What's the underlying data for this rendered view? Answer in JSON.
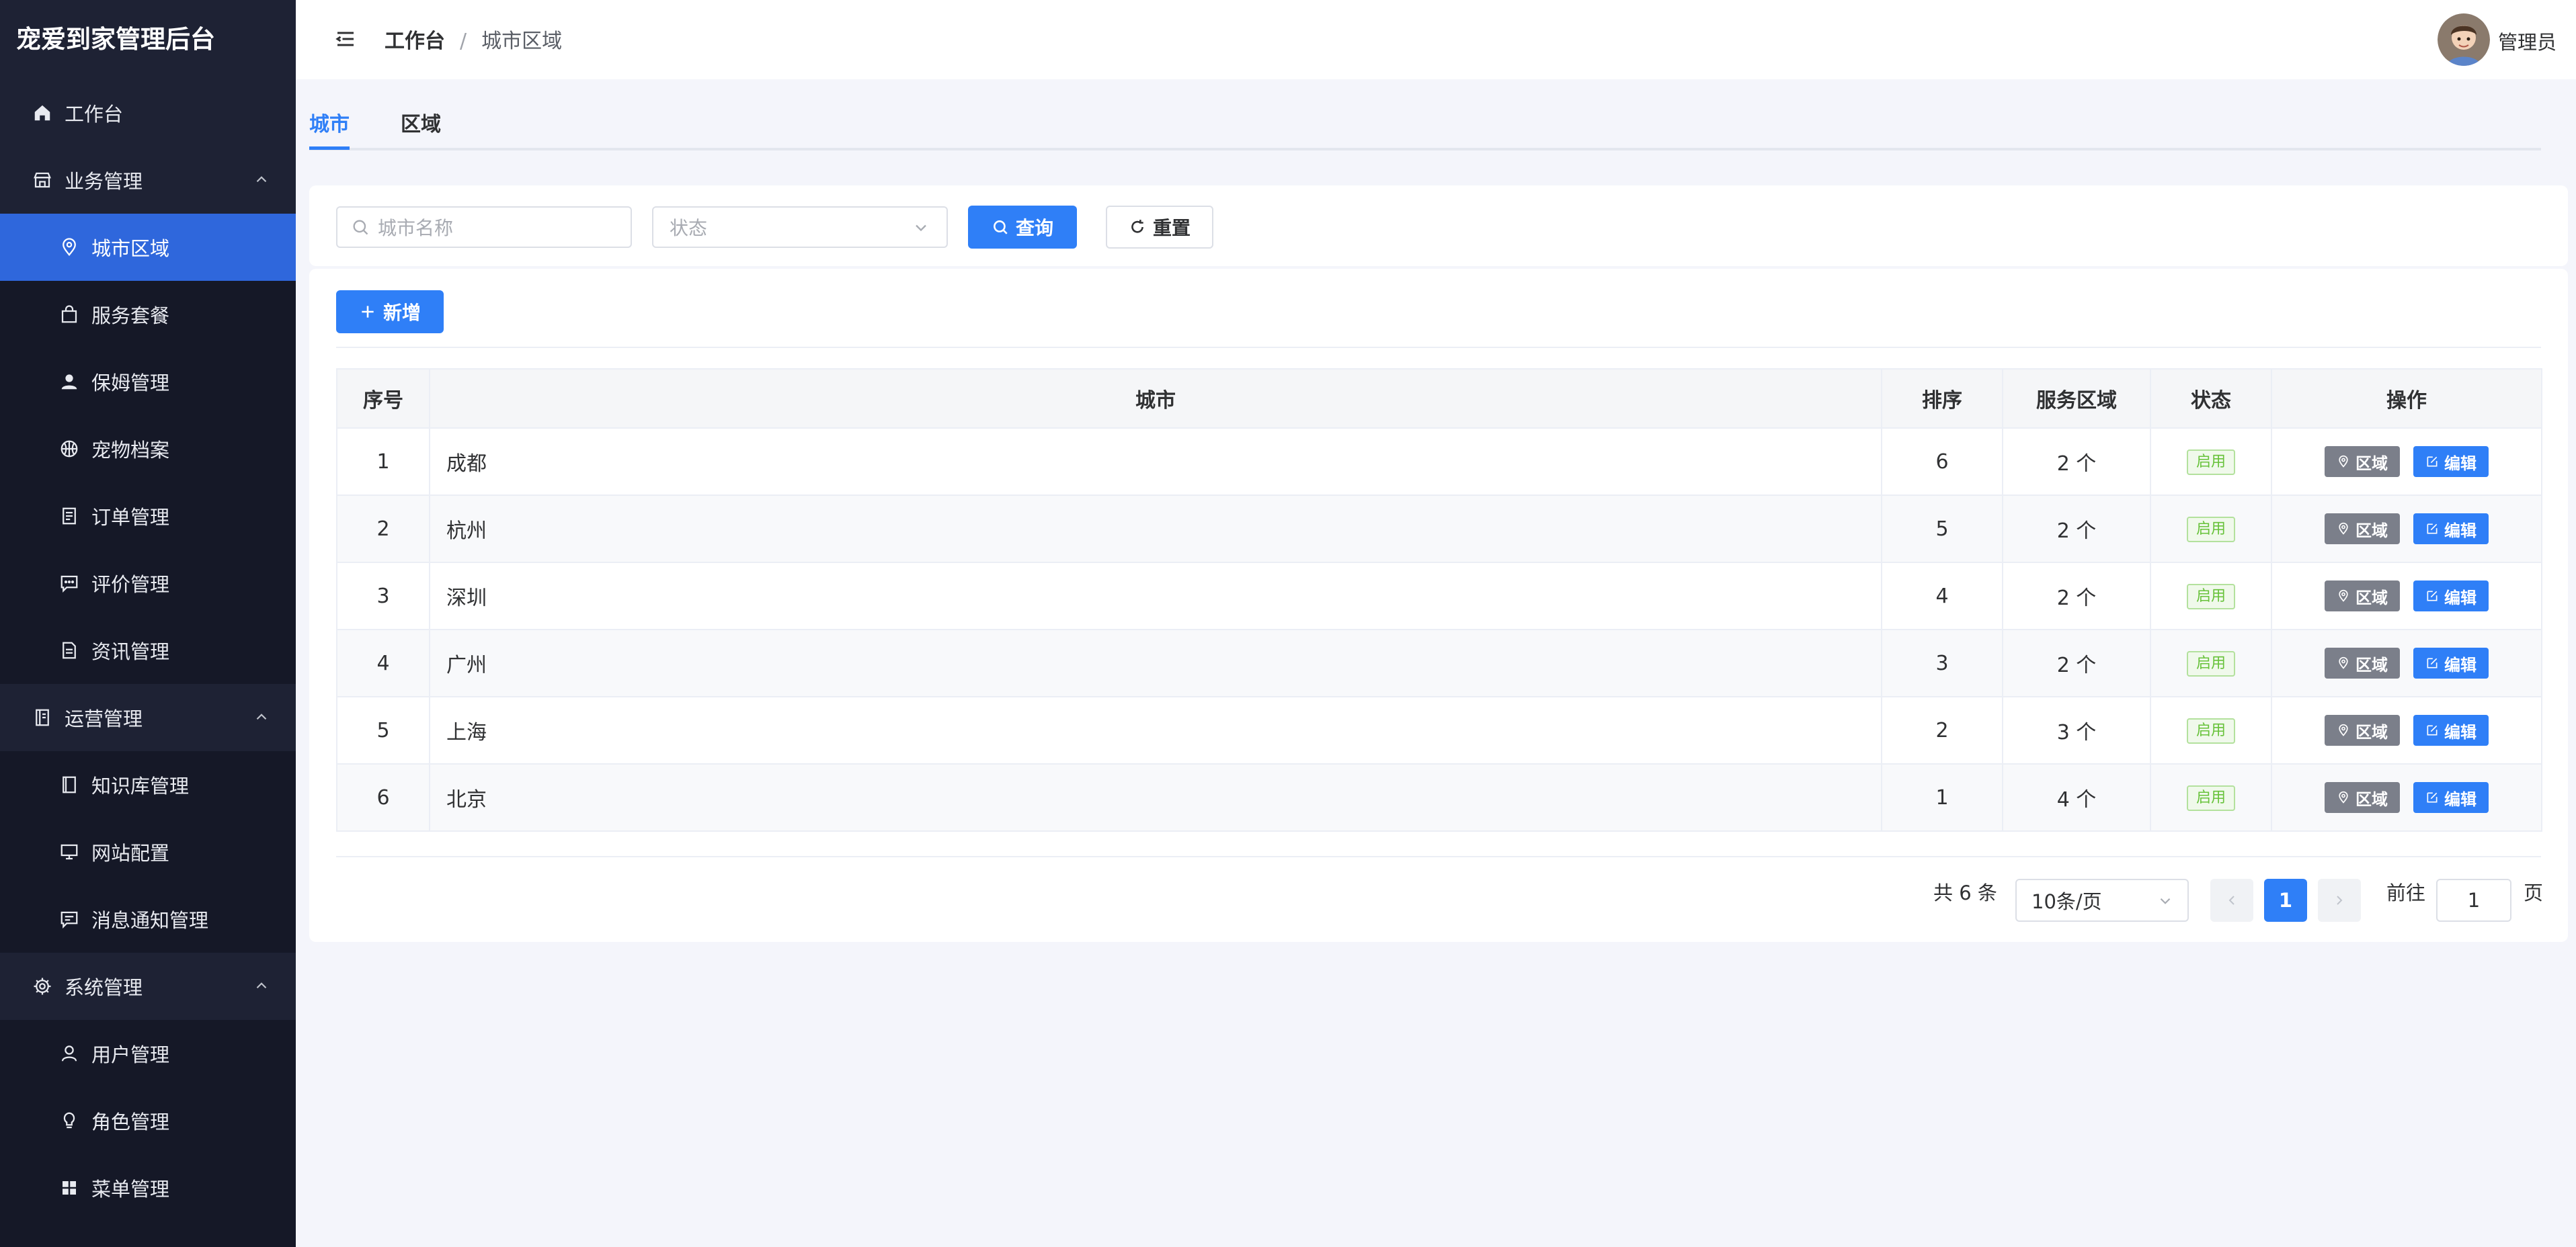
{
  "brand": "宠爱到家管理后台",
  "sidebar": {
    "items": [
      {
        "label": "工作台",
        "icon": "home-icon"
      },
      {
        "label": "业务管理",
        "icon": "store-icon"
      },
      {
        "label": "城市区域",
        "icon": "map-pin-icon"
      },
      {
        "label": "服务套餐",
        "icon": "bag-icon"
      },
      {
        "label": "保姆管理",
        "icon": "user-filled-icon"
      },
      {
        "label": "宠物档案",
        "icon": "basketball-icon"
      },
      {
        "label": "订单管理",
        "icon": "document-icon"
      },
      {
        "label": "评价管理",
        "icon": "chat-icon"
      },
      {
        "label": "资讯管理",
        "icon": "news-icon"
      },
      {
        "label": "运营管理",
        "icon": "notebook-icon"
      },
      {
        "label": "知识库管理",
        "icon": "book-icon"
      },
      {
        "label": "网站配置",
        "icon": "monitor-icon"
      },
      {
        "label": "消息通知管理",
        "icon": "message-icon"
      },
      {
        "label": "系统管理",
        "icon": "gear-icon"
      },
      {
        "label": "用户管理",
        "icon": "user-icon"
      },
      {
        "label": "角色管理",
        "icon": "bulb-icon"
      },
      {
        "label": "菜单管理",
        "icon": "grid-icon"
      }
    ]
  },
  "header": {
    "breadcrumb": [
      "工作台",
      "城市区域"
    ],
    "separator": "/",
    "username": "管理员"
  },
  "tabs": [
    "城市",
    "区域"
  ],
  "search": {
    "city_placeholder": "城市名称",
    "status_placeholder": "状态",
    "query_label": "查询",
    "reset_label": "重置"
  },
  "toolbar": {
    "add_label": "新增"
  },
  "table": {
    "headers": [
      "序号",
      "城市",
      "排序",
      "服务区域",
      "状态",
      "操作"
    ],
    "rows": [
      {
        "index": "1",
        "city": "成都",
        "sort": "6",
        "areas": "2 个",
        "status": "启用"
      },
      {
        "index": "2",
        "city": "杭州",
        "sort": "5",
        "areas": "2 个",
        "status": "启用"
      },
      {
        "index": "3",
        "city": "深圳",
        "sort": "4",
        "areas": "2 个",
        "status": "启用"
      },
      {
        "index": "4",
        "city": "广州",
        "sort": "3",
        "areas": "2 个",
        "status": "启用"
      },
      {
        "index": "5",
        "city": "上海",
        "sort": "2",
        "areas": "3 个",
        "status": "启用"
      },
      {
        "index": "6",
        "city": "北京",
        "sort": "1",
        "areas": "4 个",
        "status": "启用"
      }
    ],
    "action_area": "区域",
    "action_edit": "编辑"
  },
  "pagination": {
    "total_text": "共 6 条",
    "page_size": "10条/页",
    "current_page": "1",
    "goto_prefix": "前往",
    "goto_value": "1",
    "goto_suffix": "页"
  },
  "colors": {
    "sidebar_bg": "#1e2234",
    "active_menu": "#2f67dc",
    "primary": "#2f7ff7",
    "status_green": "#67c23a",
    "area_button_gray": "#7b7f8a"
  }
}
